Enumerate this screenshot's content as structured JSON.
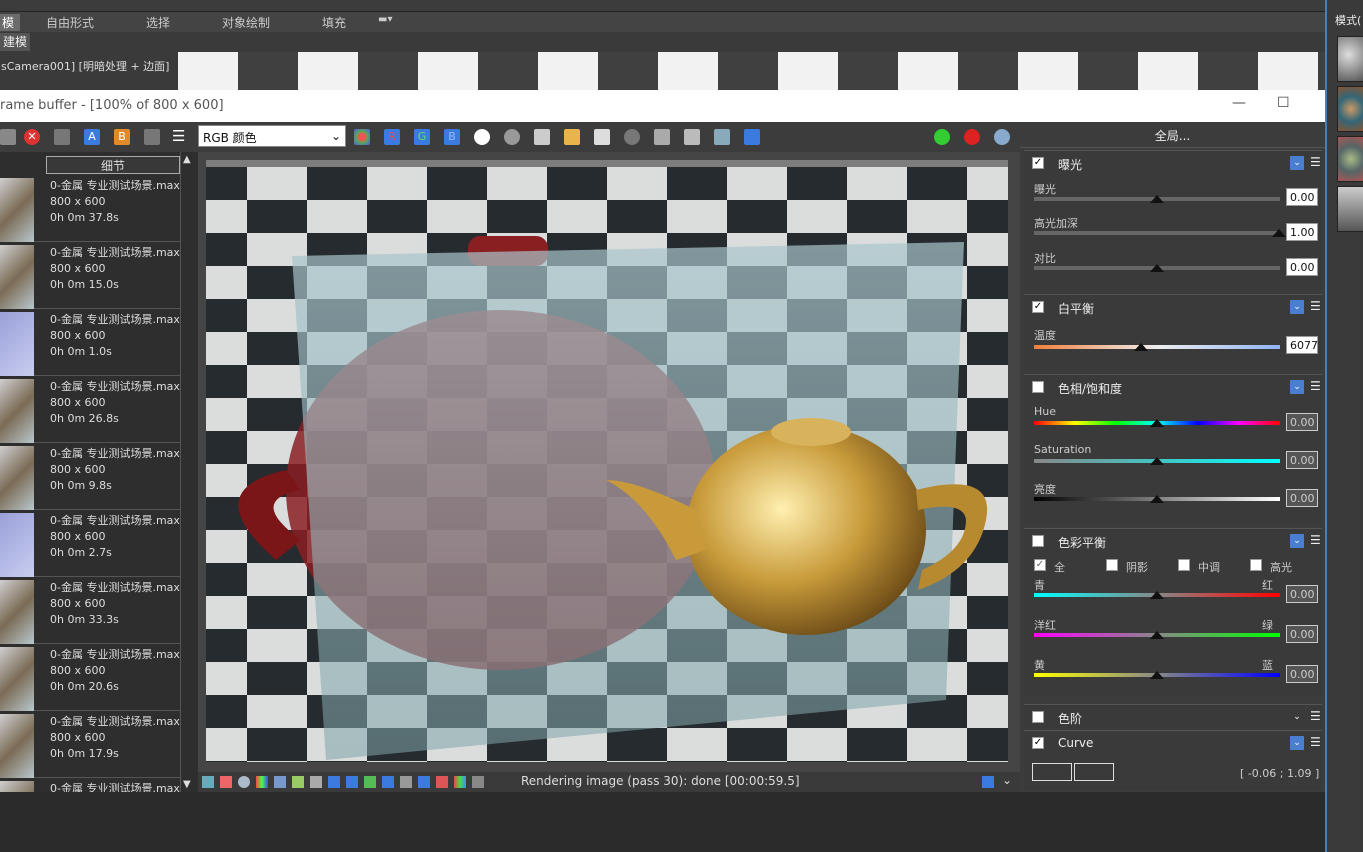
{
  "ribbon": {
    "tabs": [
      "自由形式",
      "选择",
      "对象绘制",
      "填充"
    ],
    "active_tab": "模",
    "subtab": "建模"
  },
  "viewport": {
    "label": "sCamera001] [明暗处理 + 边面]"
  },
  "right_panel": {
    "title": "模式("
  },
  "frame_buffer": {
    "title": "rame buffer - [100% of 800 x 600]",
    "minimize": "—",
    "maximize": "☐",
    "channel_select": "RGB 颜色",
    "toolbar_labels": {
      "a": "A",
      "b": "B",
      "r": "R",
      "g": "G",
      "bl": "B"
    },
    "history": {
      "column_header": "细节",
      "items": [
        {
          "name": "0-金属 专业测试场景.max",
          "size": "800 x 600",
          "time": "0h 0m 37.8s"
        },
        {
          "name": "0-金属 专业测试场景.max",
          "size": "800 x 600",
          "time": "0h 0m 15.0s"
        },
        {
          "name": "0-金属 专业测试场景.max",
          "size": "800 x 600",
          "time": "0h 0m 1.0s"
        },
        {
          "name": "0-金属 专业测试场景.max",
          "size": "800 x 600",
          "time": "0h 0m 26.8s"
        },
        {
          "name": "0-金属 专业测试场景.max",
          "size": "800 x 600",
          "time": "0h 0m 9.8s"
        },
        {
          "name": "0-金属 专业测试场景.max",
          "size": "800 x 600",
          "time": "0h 0m 2.7s"
        },
        {
          "name": "0-金属 专业测试场景.max",
          "size": "800 x 600",
          "time": "0h 0m 33.3s"
        },
        {
          "name": "0-金属 专业测试场景.max",
          "size": "800 x 600",
          "time": "0h 0m 20.6s"
        },
        {
          "name": "0-金属 专业测试场景.max",
          "size": "800 x 600",
          "time": "0h 0m 17.9s"
        },
        {
          "name": "0-金属 专业测试场景.max",
          "size": "",
          "time": ""
        }
      ]
    },
    "status": "Rendering image (pass 30): done [00:00:59.5]"
  },
  "color_corrections": {
    "header": "全局...",
    "exposure": {
      "title": "曝光",
      "enabled": true,
      "exposure_label": "曝光",
      "exposure_value": "0.00",
      "highlight_label": "高光加深",
      "highlight_value": "1.00",
      "contrast_label": "对比",
      "contrast_value": "0.00"
    },
    "white_balance": {
      "title": "白平衡",
      "enabled": true,
      "temp_label": "温度",
      "temp_value": "6077"
    },
    "hue_sat": {
      "title": "色相/饱和度",
      "enabled": false,
      "hue_label": "Hue",
      "hue_value": "0.00",
      "sat_label": "Saturation",
      "sat_value": "0.00",
      "light_label": "亮度",
      "light_value": "0.00"
    },
    "color_balance": {
      "title": "色彩平衡",
      "enabled": false,
      "all_label": "全",
      "shadows_label": "阴影",
      "midtones_label": "中调",
      "highlights_label": "高光",
      "cyan": "青",
      "red": "红",
      "magenta": "洋红",
      "green": "绿",
      "yellow": "黄",
      "blue": "蓝",
      "v1": "0.00",
      "v2": "0.00",
      "v3": "0.00"
    },
    "levels": {
      "title": "色阶",
      "enabled": false
    },
    "curve": {
      "title": "Curve",
      "enabled": true,
      "readout": "[ -0.06 ; 1.09 ]"
    }
  },
  "colors": {
    "accent": "#4a7fd0",
    "title_bar": "#ffffff",
    "panel": "#3c3c3c"
  }
}
